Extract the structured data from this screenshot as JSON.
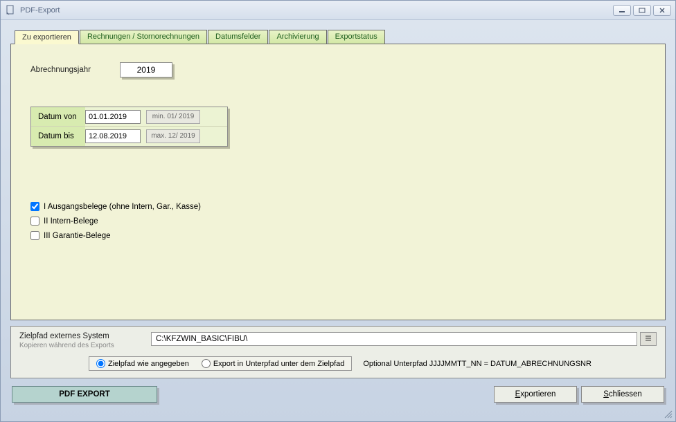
{
  "window": {
    "title": "PDF-Export"
  },
  "tabs": {
    "t0": "Zu exportieren",
    "t1": "Rechnungen / Stornorechnungen",
    "t2": "Datumsfelder",
    "t3": "Archivierung",
    "t4": "Exportstatus"
  },
  "form": {
    "year_label": "Abrechnungsjahr",
    "year_value": "2019",
    "date_from_label": "Datum von",
    "date_from_value": "01.01.2019",
    "date_from_hint": "min. 01/ 2019",
    "date_to_label": "Datum bis",
    "date_to_value": "12.08.2019",
    "date_to_hint": "max. 12/ 2019",
    "chk1": "I Ausgangsbelege (ohne Intern, Gar., Kasse)",
    "chk2": "II Intern-Belege",
    "chk3": "III Garantie-Belege"
  },
  "path": {
    "label": "Zielpfad externes System",
    "sub": "Kopieren während des Exports",
    "value": "C:\\KFZWIN_BASIC\\FIBU\\",
    "radio1": "Zielpfad wie angegeben",
    "radio2": "Export in Unterpfad unter dem Zielpfad",
    "optional": "Optional Unterpfad JJJJMMTT_NN = DATUM_ABRECHNUNGSNR"
  },
  "buttons": {
    "pdf": "PDF EXPORT",
    "export": "Exportieren",
    "close": "Schliessen"
  }
}
